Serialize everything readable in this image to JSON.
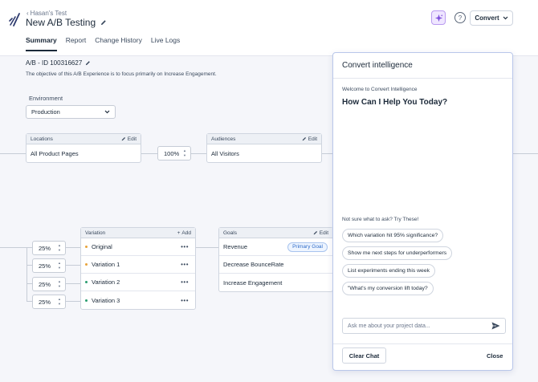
{
  "header": {
    "breadcrumb": "Hasan's Test",
    "title": "New A/B Testing",
    "account_label": "Convert",
    "help_label": "?",
    "tabs": [
      {
        "label": "Summary",
        "active": true
      },
      {
        "label": "Report",
        "active": false
      },
      {
        "label": "Change History",
        "active": false
      },
      {
        "label": "Live Logs",
        "active": false
      }
    ]
  },
  "experience": {
    "id_label": "A/B - ID 100316627",
    "objective": "The objective of this A/B Experience is to focus primarily on Increase Engagement."
  },
  "environment": {
    "label": "Environment",
    "value": "Production"
  },
  "locations": {
    "header": "Locations",
    "action": "Edit",
    "value": "All Product Pages"
  },
  "traffic": {
    "value": "100%"
  },
  "audiences": {
    "header": "Audiences",
    "action": "Edit",
    "value": "All Visitors"
  },
  "variations": {
    "header": "Variation",
    "action": "Add",
    "items": [
      {
        "name": "Original",
        "split": "25%",
        "color": "#e8a33a"
      },
      {
        "name": "Variation 1",
        "split": "25%",
        "color": "#e8a33a"
      },
      {
        "name": "Variation 2",
        "split": "25%",
        "color": "#2a9d6f"
      },
      {
        "name": "Variation 3",
        "split": "25%",
        "color": "#2a9d6f"
      }
    ],
    "more": "•••"
  },
  "goals": {
    "header": "Goals",
    "action": "Edit",
    "items": [
      {
        "name": "Revenue",
        "badge": "Primary Goal"
      },
      {
        "name": "Decrease BounceRate",
        "badge": ""
      },
      {
        "name": "Increase Engagement",
        "badge": ""
      }
    ]
  },
  "ai_panel": {
    "title": "Convert intelligence",
    "welcome": "Welcome to Convert Intelligence",
    "greeting": "How Can I Help You Today?",
    "suggest_label": "Not sure what to ask? Try These!",
    "suggestions": [
      "Which variation hit 95% significance?",
      "Show me next steps for underperformers",
      "List experiments ending this week",
      "\"What's my conversion lift today?"
    ],
    "input_placeholder": "Ask me about your project data...",
    "clear_label": "Clear Chat",
    "close_label": "Close"
  },
  "colors": {
    "accent": "#7c4ddb",
    "badge": "#2f6cc8",
    "panel_border": "#b9c7ea"
  }
}
